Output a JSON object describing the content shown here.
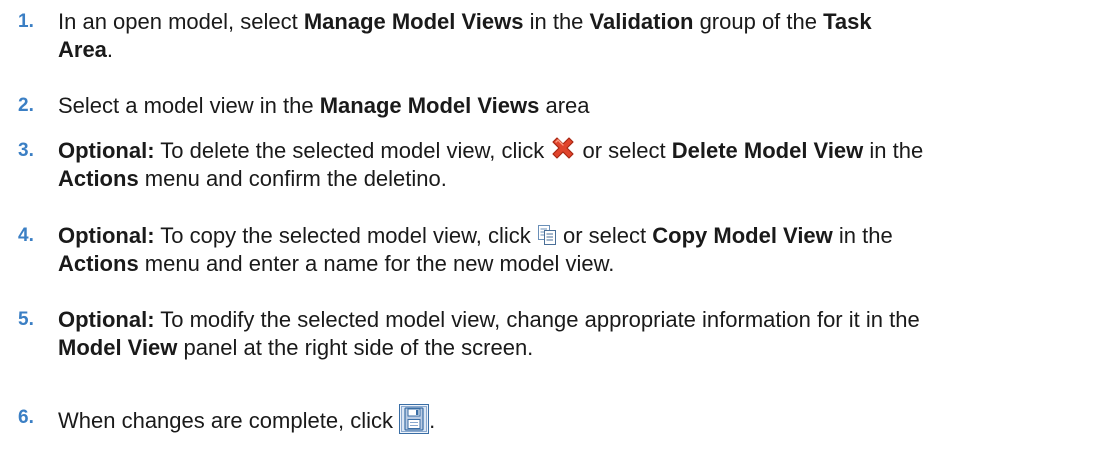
{
  "steps": [
    {
      "number": "1.",
      "line1": {
        "t1": "In an open model, select ",
        "b1": "Manage Model Views",
        "t2": " in the ",
        "b2": "Validation",
        "t3": " group of the ",
        "b3": "Task"
      },
      "line2": {
        "b1": "Area",
        "t1": "."
      }
    },
    {
      "number": "2.",
      "line1": {
        "t1": "Select a model view in the ",
        "b1": "Manage Model Views",
        "t2": " area"
      }
    },
    {
      "number": "3.",
      "line1": {
        "b1": "Optional:",
        "t1": " To delete the selected model view, click ",
        "icon": "delete-x-icon",
        "t2": " or select ",
        "b2": "Delete Model View",
        "t3": " in the"
      },
      "line2": {
        "b1": "Actions",
        "t1": " menu and confirm the deletino."
      }
    },
    {
      "number": "4.",
      "line1": {
        "b1": "Optional:",
        "t1": " To copy the selected model view, click ",
        "icon": "copy-documents-icon",
        "t2": " or select ",
        "b2": "Copy Model View",
        "t3": " in the"
      },
      "line2": {
        "b1": "Actions",
        "t1": " menu and enter a name for the new model view."
      }
    },
    {
      "number": "5.",
      "line1": {
        "b1": "Optional:",
        "t1": " To modify the selected model view, change appropriate information for it in the"
      },
      "line2": {
        "b1": "Model View",
        "t1": " panel at the right side of the screen."
      }
    },
    {
      "number": "6.",
      "line1": {
        "t1": "When changes are complete, click ",
        "icon": "save-floppy-icon",
        "t2": "."
      }
    }
  ],
  "colors": {
    "step_number": "#3b7fc4",
    "text": "#1a1a1a",
    "delete_icon": "#e0442c",
    "save_icon_border": "#3a6ea5"
  }
}
